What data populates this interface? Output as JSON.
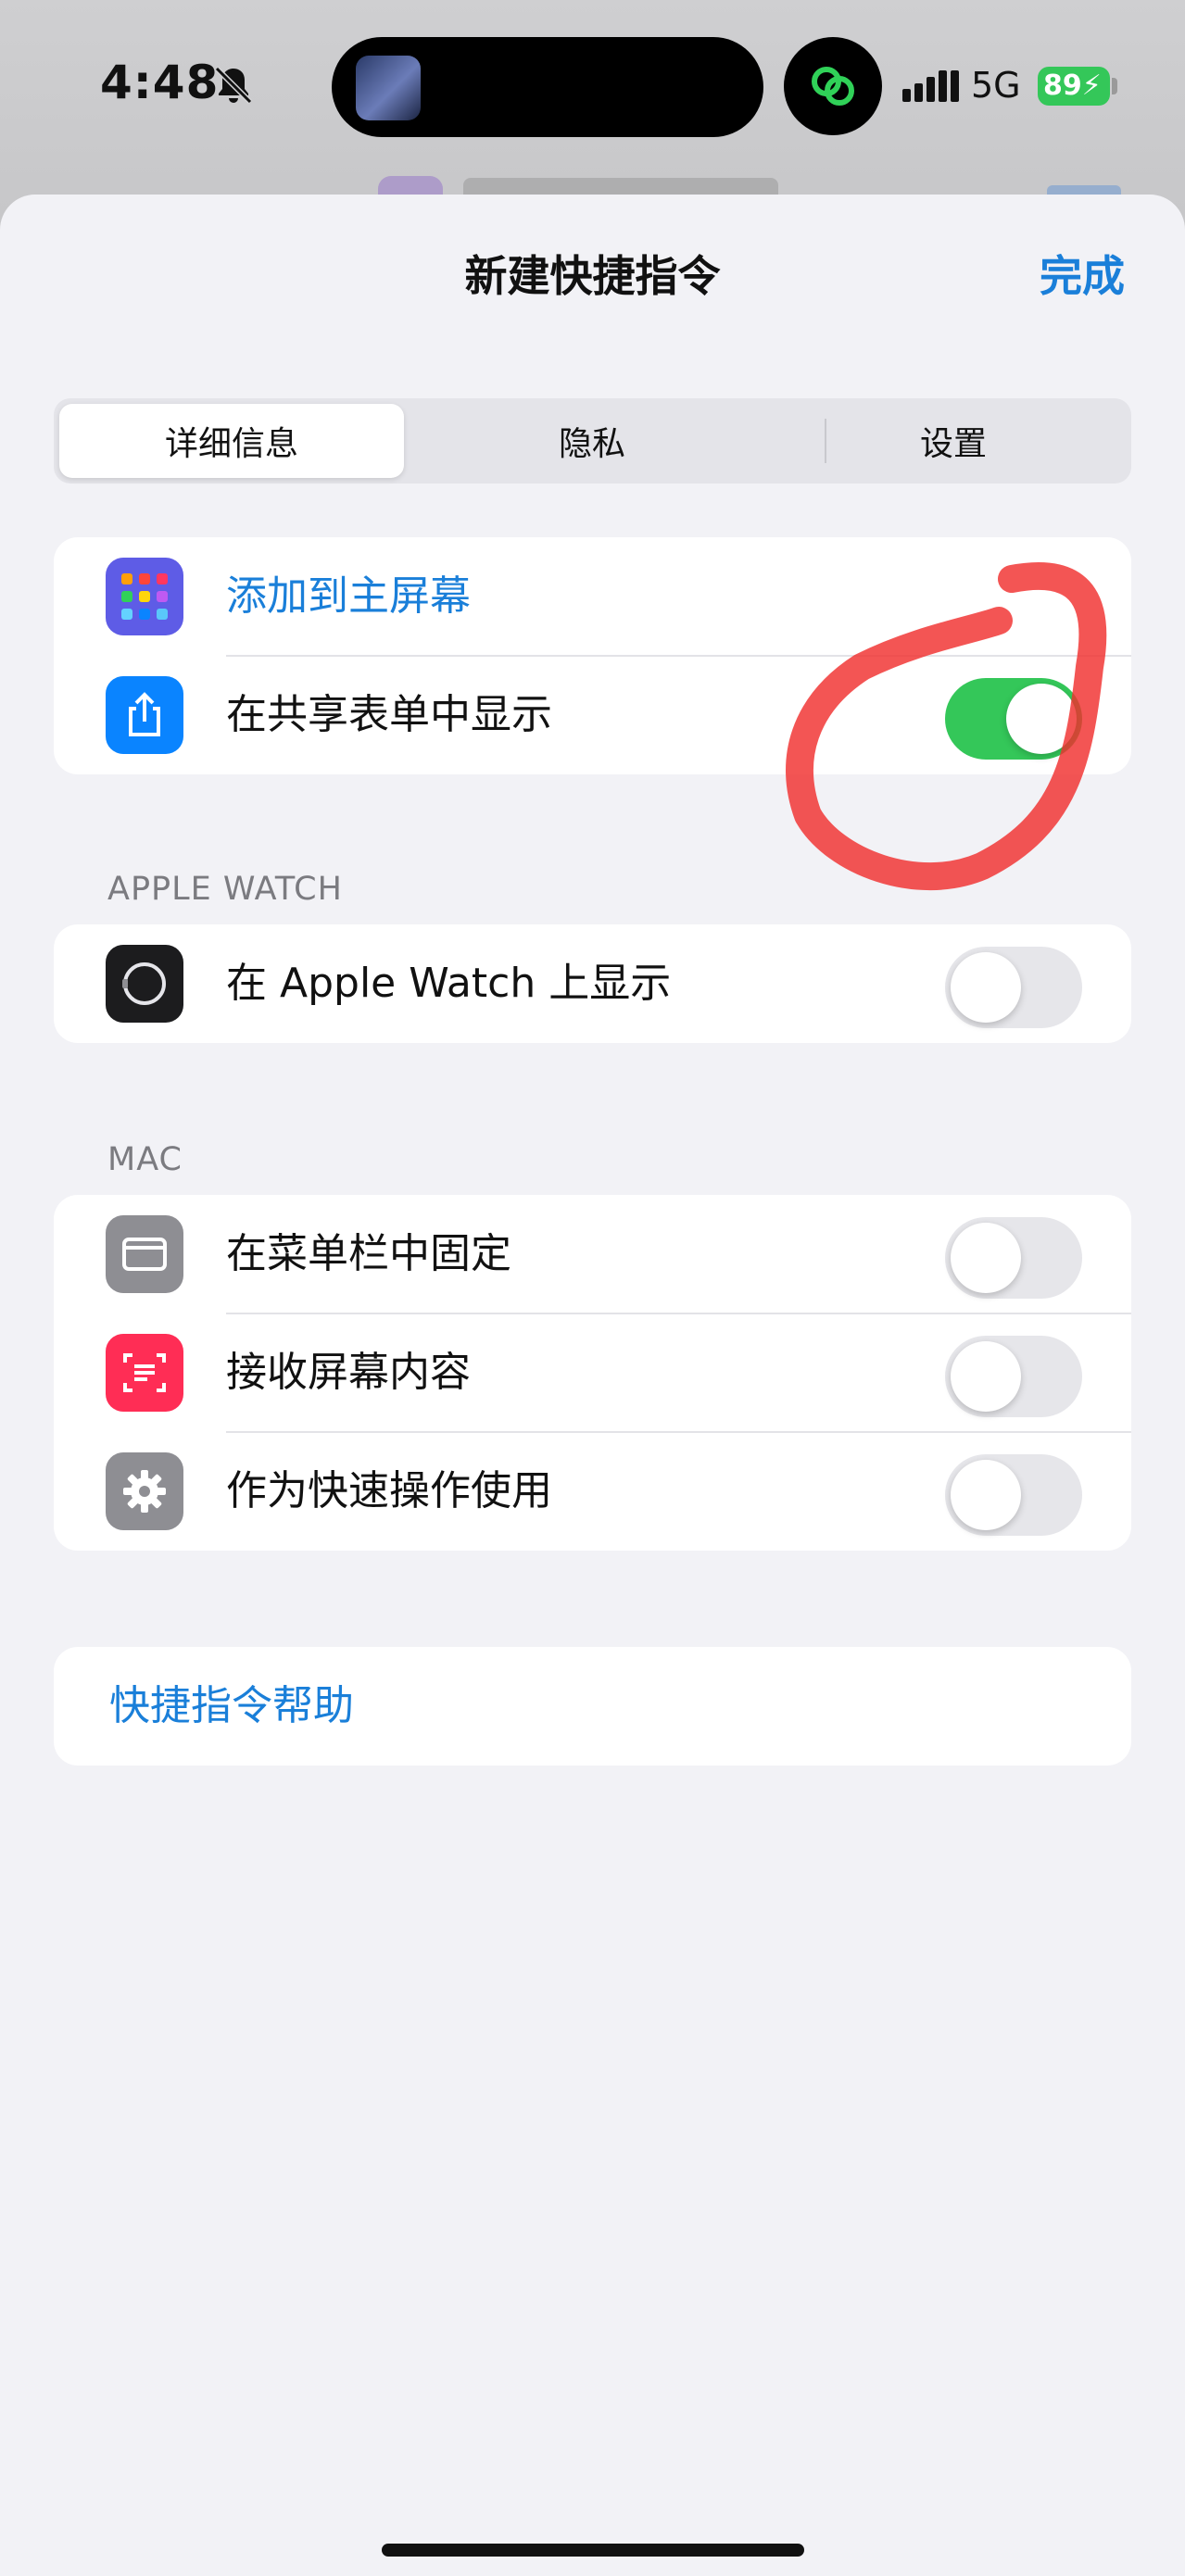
{
  "status_bar": {
    "time": "4:48",
    "network": "5G",
    "battery": "89",
    "icons": [
      "bell-slash-icon",
      "link-icon",
      "signal-icon",
      "battery-charging-icon"
    ]
  },
  "nav": {
    "title": "新建快捷指令",
    "done": "完成"
  },
  "segmented": {
    "tabs": [
      {
        "label": "详细信息",
        "selected": true
      },
      {
        "label": "隐私",
        "selected": false
      },
      {
        "label": "设置",
        "selected": false
      }
    ]
  },
  "general": {
    "rows": [
      {
        "label": "添加到主屏幕",
        "icon": "grid-icon",
        "icon_color": "#5e5ce6",
        "link": true
      },
      {
        "label": "在共享表单中显示",
        "icon": "share-icon",
        "icon_color": "#0a84ff",
        "toggle_on": true
      }
    ]
  },
  "watch": {
    "header": "APPLE WATCH",
    "rows": [
      {
        "label": "在 Apple Watch 上显示",
        "icon": "watch-icon",
        "icon_color": "#1c1c1e",
        "toggle_on": false
      }
    ]
  },
  "mac": {
    "header": "MAC",
    "rows": [
      {
        "label": "在菜单栏中固定",
        "icon": "menubar-icon",
        "icon_color": "#8e8e93",
        "toggle_on": false
      },
      {
        "label": "接收屏幕内容",
        "icon": "screen-scan-icon",
        "icon_color": "#ff2d55",
        "toggle_on": false
      },
      {
        "label": "作为快速操作使用",
        "icon": "gear-icon",
        "icon_color": "#8e8e93",
        "toggle_on": false
      }
    ]
  },
  "help": {
    "label": "快捷指令帮助"
  },
  "annotation": {
    "color": "#f0302e",
    "shape": "hand-drawn-circle-around-share-toggle"
  }
}
